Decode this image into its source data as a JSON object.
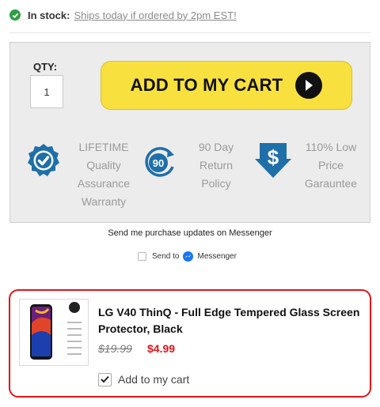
{
  "stock": {
    "label": "In stock:",
    "link_text": "Ships today if ordered by 2pm EST!"
  },
  "purchase": {
    "qty_label": "QTY:",
    "qty_value": "1",
    "add_to_cart_label": "ADD TO MY CART"
  },
  "features": [
    {
      "icon": "checkmark-badge-icon",
      "lines": [
        "LIFETIME",
        "Quality",
        "Assurance",
        "Warranty"
      ]
    },
    {
      "icon": "90-day-return-icon",
      "icon_text": "90",
      "lines": [
        "90 Day",
        "Return",
        "Policy"
      ]
    },
    {
      "icon": "dollar-shield-icon",
      "lines": [
        "110% Low",
        "Price",
        "Garauntee"
      ]
    }
  ],
  "messenger": {
    "title": "Send me purchase updates on Messenger",
    "send_to": "Send to",
    "brand": "Messenger"
  },
  "product": {
    "title_line1": "LG V40 ThinQ - Full Edge Tempered Glass Screen",
    "title_line2": "Protector, Black",
    "old_price": "$19.99",
    "new_price": "$4.99",
    "add_label": "Add to my cart",
    "add_checked": true
  },
  "colors": {
    "accent_yellow": "#f8e13f",
    "icon_blue": "#1f6fa8",
    "sale_red": "#e0141a",
    "stock_green": "#2f9e44",
    "highlight_border": "#e3141a",
    "messenger_blue": "#1877f2"
  }
}
